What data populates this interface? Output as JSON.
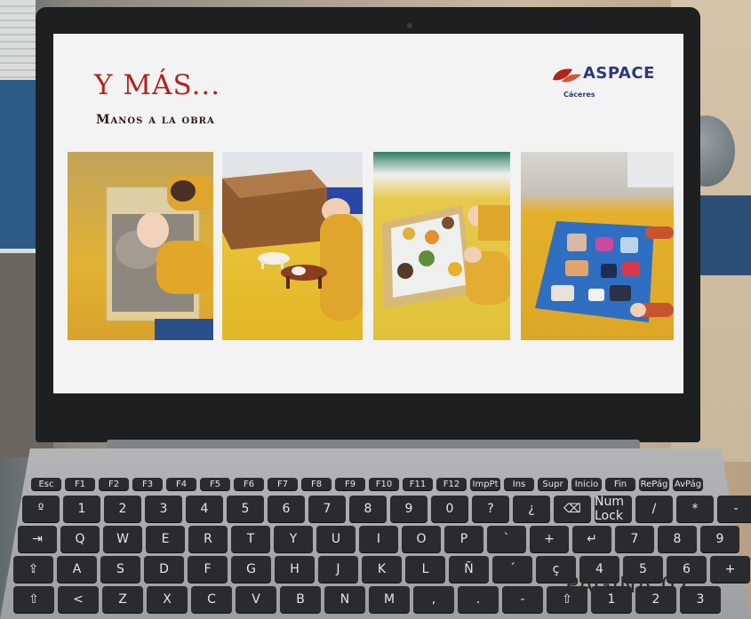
{
  "slide": {
    "title": "Y MÁS...",
    "subtitle": "Manos a la obra"
  },
  "logo": {
    "text": "ASPACE",
    "subtext": "Cáceres",
    "brand_color": "#2b3a78",
    "accent_color": "#b2231b"
  },
  "photos": [
    {
      "name": "kinetic-sand-tray-photo"
    },
    {
      "name": "wooden-box-animals-photo"
    },
    {
      "name": "wooden-puzzle-board-photo"
    },
    {
      "name": "blue-puzzle-board-photo"
    }
  ],
  "keyboard": {
    "row1": [
      "Esc",
      "F1",
      "F2",
      "F3",
      "F4",
      "F5",
      "F6",
      "F7",
      "F8",
      "F9",
      "F10",
      "F11",
      "F12",
      "ImpPt",
      "Ins",
      "Supr",
      "Inicio",
      "Fin",
      "RePág",
      "AvPág"
    ],
    "row2": [
      "º",
      "1",
      "2",
      "3",
      "4",
      "5",
      "6",
      "7",
      "8",
      "9",
      "0",
      "?",
      "¿",
      "⌫",
      "Num Lock",
      "/",
      "*",
      "-"
    ],
    "row3": [
      "⇥",
      "Q",
      "W",
      "E",
      "R",
      "T",
      "Y",
      "U",
      "I",
      "O",
      "P",
      "`",
      "+",
      "↵",
      "7",
      "8",
      "9"
    ],
    "row4": [
      "⇪",
      "A",
      "S",
      "D",
      "F",
      "G",
      "H",
      "J",
      "K",
      "L",
      "Ñ",
      "´",
      "ç",
      "4",
      "5",
      "6",
      "+"
    ],
    "row5": [
      "⇧",
      "<",
      "Z",
      "X",
      "C",
      "V",
      "B",
      "N",
      "M",
      ",",
      ".",
      "-",
      "⇧",
      "1",
      "2",
      "3"
    ]
  },
  "page_label": "PÁGINA 07"
}
